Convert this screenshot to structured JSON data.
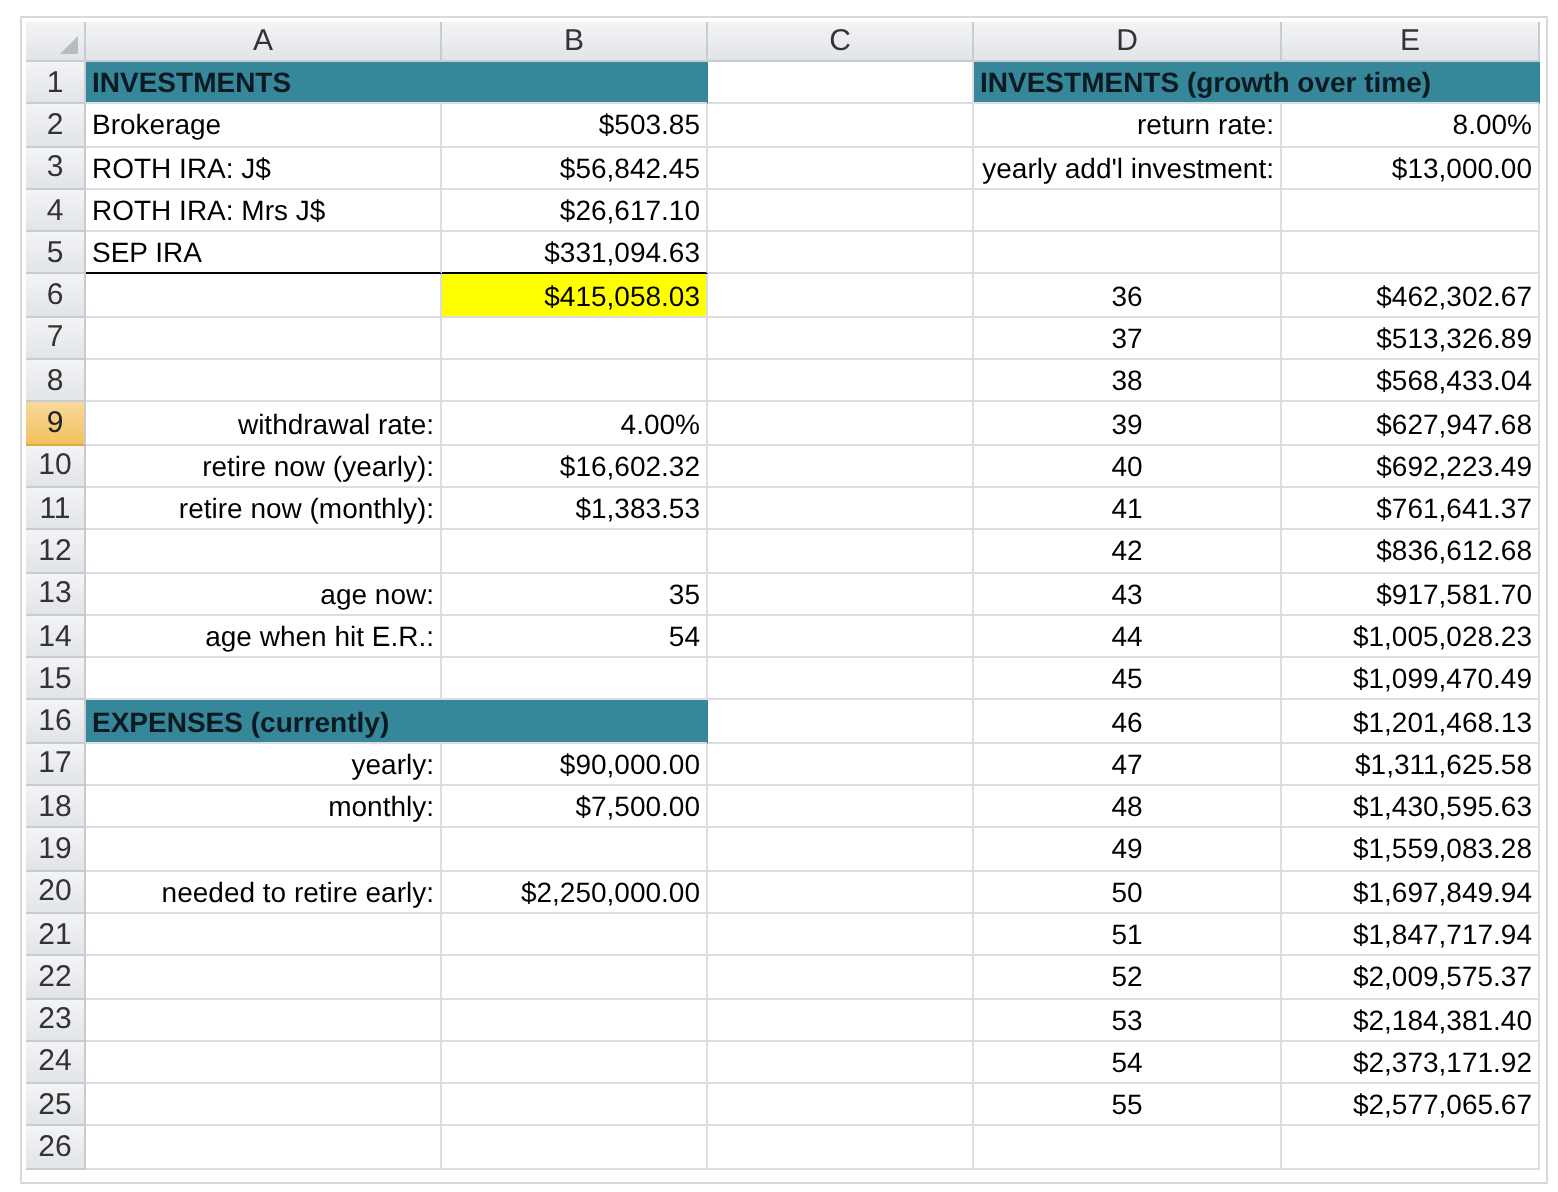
{
  "columns": [
    "A",
    "B",
    "C",
    "D",
    "E"
  ],
  "rows": [
    {
      "number": "1",
      "selected": false,
      "cells": [
        {
          "kind": "section",
          "text": "INVESTMENTS"
        },
        null,
        {
          "kind": "section",
          "text": "INVESTMENTS (growth over time)"
        }
      ]
    },
    {
      "number": "2",
      "selected": false,
      "cells": [
        {
          "kind": "text",
          "text": "Brokerage"
        },
        {
          "kind": "number",
          "text": "$503.85"
        },
        null,
        {
          "kind": "number",
          "text": "return rate:"
        },
        {
          "kind": "number",
          "text": "8.00%"
        }
      ]
    },
    {
      "number": "3",
      "selected": false,
      "cells": [
        {
          "kind": "text",
          "text": "ROTH IRA: J$"
        },
        {
          "kind": "number",
          "text": "$56,842.45"
        },
        null,
        {
          "kind": "number",
          "text": "yearly add'l investment:"
        },
        {
          "kind": "number",
          "text": "$13,000.00"
        }
      ]
    },
    {
      "number": "4",
      "selected": false,
      "cells": [
        {
          "kind": "text",
          "text": "ROTH IRA: Mrs J$"
        },
        {
          "kind": "number",
          "text": "$26,617.10"
        },
        null,
        null,
        null
      ]
    },
    {
      "number": "5",
      "selected": false,
      "underlined": true,
      "cells": [
        {
          "kind": "text",
          "text": "SEP IRA"
        },
        {
          "kind": "number",
          "text": "$331,094.63"
        },
        null,
        null,
        null
      ]
    },
    {
      "number": "6",
      "selected": false,
      "cells": [
        null,
        {
          "kind": "total",
          "text": "$415,058.03"
        },
        null,
        {
          "kind": "center",
          "text": "36"
        },
        {
          "kind": "number",
          "text": "$462,302.67"
        }
      ]
    },
    {
      "number": "7",
      "selected": false,
      "cells": [
        null,
        null,
        null,
        {
          "kind": "center",
          "text": "37"
        },
        {
          "kind": "number",
          "text": "$513,326.89"
        }
      ]
    },
    {
      "number": "8",
      "selected": false,
      "cells": [
        null,
        null,
        null,
        {
          "kind": "center",
          "text": "38"
        },
        {
          "kind": "number",
          "text": "$568,433.04"
        }
      ]
    },
    {
      "number": "9",
      "selected": true,
      "cells": [
        {
          "kind": "number",
          "text": "withdrawal rate:"
        },
        {
          "kind": "number",
          "text": "4.00%"
        },
        null,
        {
          "kind": "center",
          "text": "39"
        },
        {
          "kind": "number",
          "text": "$627,947.68"
        }
      ]
    },
    {
      "number": "10",
      "selected": false,
      "cells": [
        {
          "kind": "number",
          "text": "retire now (yearly):"
        },
        {
          "kind": "number",
          "text": "$16,602.32"
        },
        null,
        {
          "kind": "center",
          "text": "40"
        },
        {
          "kind": "number",
          "text": "$692,223.49"
        }
      ]
    },
    {
      "number": "11",
      "selected": false,
      "cells": [
        {
          "kind": "number",
          "text": "retire now (monthly):"
        },
        {
          "kind": "number",
          "text": "$1,383.53"
        },
        null,
        {
          "kind": "center",
          "text": "41"
        },
        {
          "kind": "number",
          "text": "$761,641.37"
        }
      ]
    },
    {
      "number": "12",
      "selected": false,
      "cells": [
        null,
        null,
        null,
        {
          "kind": "center",
          "text": "42"
        },
        {
          "kind": "number",
          "text": "$836,612.68"
        }
      ]
    },
    {
      "number": "13",
      "selected": false,
      "cells": [
        {
          "kind": "number",
          "text": "age now:"
        },
        {
          "kind": "number",
          "text": "35"
        },
        null,
        {
          "kind": "center",
          "text": "43"
        },
        {
          "kind": "number",
          "text": "$917,581.70"
        }
      ]
    },
    {
      "number": "14",
      "selected": false,
      "cells": [
        {
          "kind": "number",
          "text": "age when hit E.R.:"
        },
        {
          "kind": "number",
          "text": "54"
        },
        null,
        {
          "kind": "center",
          "text": "44"
        },
        {
          "kind": "number",
          "text": "$1,005,028.23"
        }
      ]
    },
    {
      "number": "15",
      "selected": false,
      "cells": [
        null,
        null,
        null,
        {
          "kind": "center",
          "text": "45"
        },
        {
          "kind": "number",
          "text": "$1,099,470.49"
        }
      ]
    },
    {
      "number": "16",
      "selected": false,
      "cells": [
        {
          "kind": "section",
          "text": "EXPENSES (currently)"
        },
        null,
        {
          "kind": "center",
          "text": "46"
        },
        {
          "kind": "number",
          "text": "$1,201,468.13"
        }
      ]
    },
    {
      "number": "17",
      "selected": false,
      "cells": [
        {
          "kind": "number",
          "text": "yearly:"
        },
        {
          "kind": "number",
          "text": "$90,000.00"
        },
        null,
        {
          "kind": "center",
          "text": "47"
        },
        {
          "kind": "number",
          "text": "$1,311,625.58"
        }
      ]
    },
    {
      "number": "18",
      "selected": false,
      "cells": [
        {
          "kind": "number",
          "text": "monthly:"
        },
        {
          "kind": "number",
          "text": "$7,500.00"
        },
        null,
        {
          "kind": "center",
          "text": "48"
        },
        {
          "kind": "number",
          "text": "$1,430,595.63"
        }
      ]
    },
    {
      "number": "19",
      "selected": false,
      "cells": [
        null,
        null,
        null,
        {
          "kind": "center",
          "text": "49"
        },
        {
          "kind": "number",
          "text": "$1,559,083.28"
        }
      ]
    },
    {
      "number": "20",
      "selected": false,
      "cells": [
        {
          "kind": "number",
          "text": "needed to retire early:"
        },
        {
          "kind": "number",
          "text": "$2,250,000.00"
        },
        null,
        {
          "kind": "center",
          "text": "50"
        },
        {
          "kind": "number",
          "text": "$1,697,849.94"
        }
      ]
    },
    {
      "number": "21",
      "selected": false,
      "cells": [
        null,
        null,
        null,
        {
          "kind": "center",
          "text": "51"
        },
        {
          "kind": "number",
          "text": "$1,847,717.94"
        }
      ]
    },
    {
      "number": "22",
      "selected": false,
      "cells": [
        null,
        null,
        null,
        {
          "kind": "center",
          "text": "52"
        },
        {
          "kind": "number",
          "text": "$2,009,575.37"
        }
      ]
    },
    {
      "number": "23",
      "selected": false,
      "cells": [
        null,
        null,
        null,
        {
          "kind": "center",
          "text": "53"
        },
        {
          "kind": "number",
          "text": "$2,184,381.40"
        }
      ]
    },
    {
      "number": "24",
      "selected": false,
      "cells": [
        null,
        null,
        null,
        {
          "kind": "center",
          "text": "54"
        },
        {
          "kind": "number",
          "text": "$2,373,171.92"
        }
      ]
    },
    {
      "number": "25",
      "selected": false,
      "cells": [
        null,
        null,
        null,
        {
          "kind": "center",
          "text": "55"
        },
        {
          "kind": "number",
          "text": "$2,577,065.67"
        }
      ]
    },
    {
      "number": "26",
      "selected": false,
      "cells": [
        null,
        null,
        null,
        null,
        null
      ]
    }
  ]
}
